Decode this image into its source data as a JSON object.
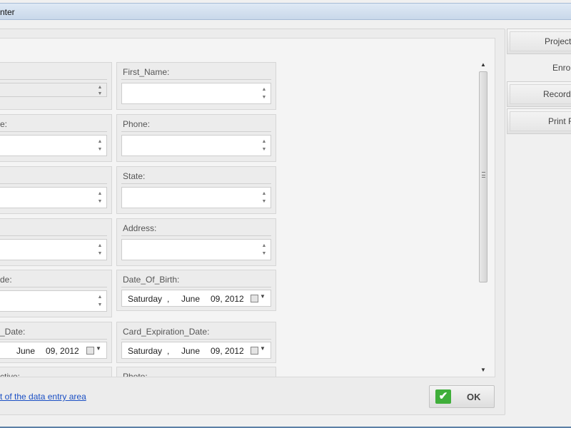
{
  "window": {
    "title": "nter"
  },
  "fields": [
    {
      "label": "",
      "value": "",
      "type": "number-disabled"
    },
    {
      "label": "First_Name:",
      "value": "",
      "type": "text"
    },
    {
      "label": "e:",
      "value": "",
      "type": "text"
    },
    {
      "label": "Phone:",
      "value": "",
      "type": "text"
    },
    {
      "label": "",
      "value": "",
      "type": "text"
    },
    {
      "label": "State:",
      "value": "",
      "type": "text"
    },
    {
      "label": "",
      "value": "",
      "type": "text"
    },
    {
      "label": "Address:",
      "value": "",
      "type": "text"
    },
    {
      "label": "de:",
      "value": "",
      "type": "text"
    },
    {
      "label": "Date_Of_Birth:",
      "type": "date",
      "day": "Saturday",
      "comma": ",",
      "month": "June",
      "year": "09, 2012"
    },
    {
      "label": "_Date:",
      "type": "date",
      "day": "",
      "comma": "",
      "month": "June",
      "year": "09, 2012"
    },
    {
      "label": "Card_Expiration_Date:",
      "type": "date",
      "day": "Saturday",
      "comma": ",",
      "month": "June",
      "year": "09, 2012"
    },
    {
      "label": "ctive:",
      "type": "text"
    },
    {
      "label": "Photo:",
      "type": "text"
    }
  ],
  "footer": {
    "link_text": "t of the data entry area",
    "ok_label": "OK"
  },
  "tabs": [
    {
      "label": "Project",
      "active": false
    },
    {
      "label": "Enro",
      "active": true
    },
    {
      "label": "Record",
      "active": false
    },
    {
      "label": "Print F",
      "active": false
    }
  ],
  "icons": {
    "spin": "spin-arrows-icon",
    "calendar": "calendar-icon",
    "ok": "checkmark-icon",
    "colors": {
      "ok_check": "#3fae3a",
      "link": "#1a4fc4"
    }
  }
}
